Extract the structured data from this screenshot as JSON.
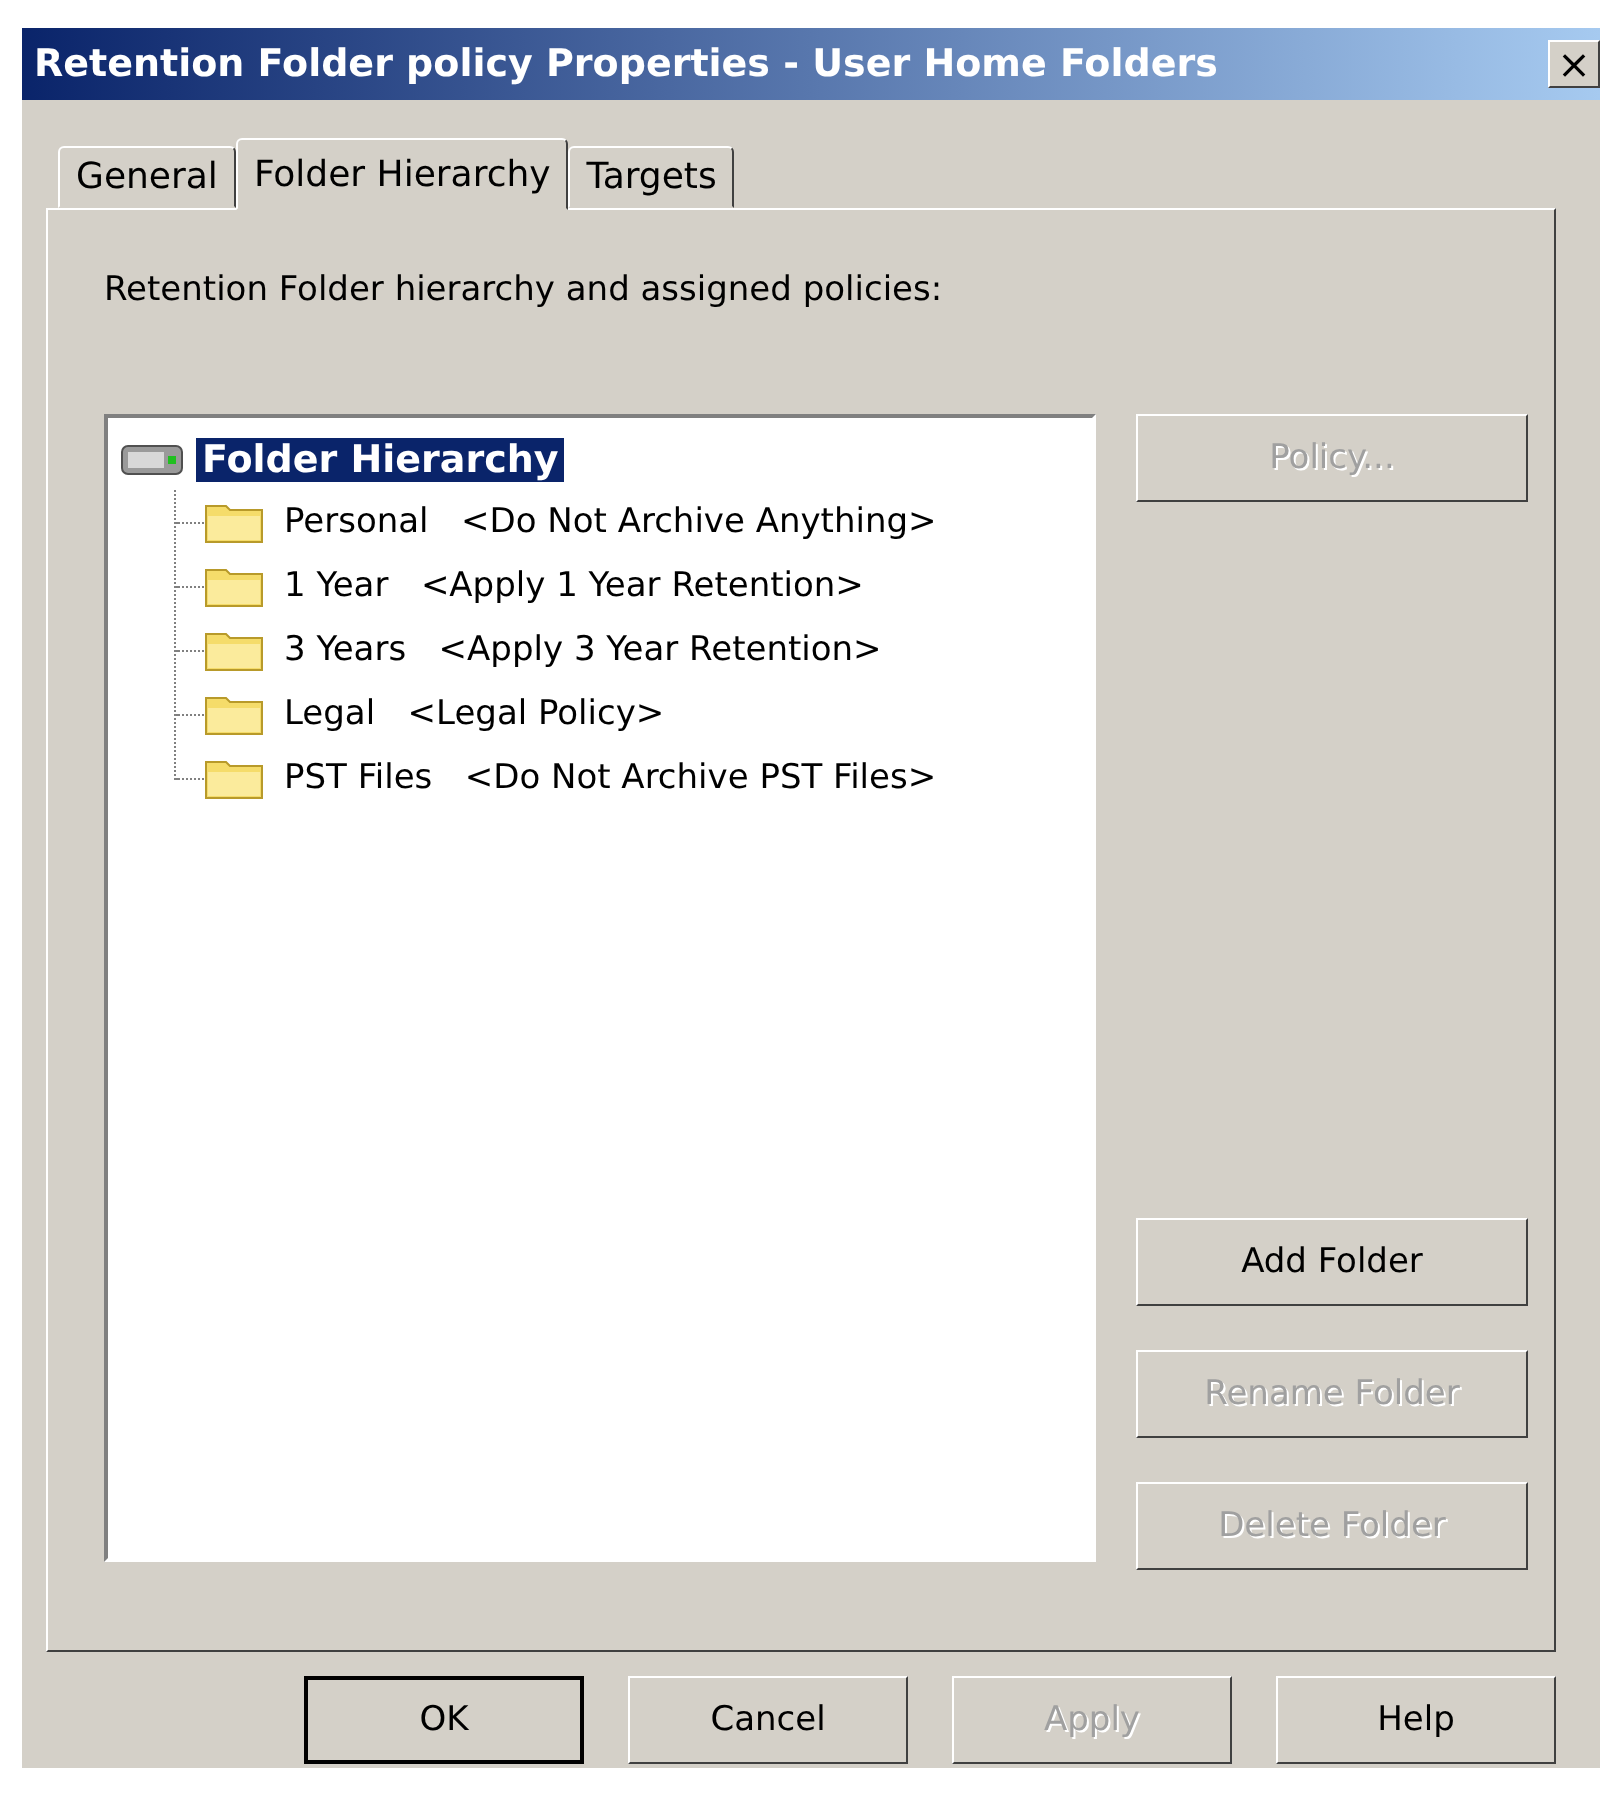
{
  "window": {
    "title": "Retention Folder policy Properties - User Home Folders",
    "close": "×"
  },
  "tabs": [
    {
      "label": "General",
      "selected": false
    },
    {
      "label": "Folder Hierarchy",
      "selected": true
    },
    {
      "label": "Targets",
      "selected": false
    }
  ],
  "panel": {
    "label": "Retention Folder hierarchy and assigned policies:"
  },
  "tree": {
    "root": {
      "label": "Folder Hierarchy",
      "selected": true
    },
    "children": [
      {
        "name": "Personal",
        "policy": "<Do Not Archive Anything>",
        "selected": false
      },
      {
        "name": "1 Year",
        "policy": "<Apply 1 Year Retention>",
        "selected": false
      },
      {
        "name": "3 Years",
        "policy": "<Apply 3 Year Retention>",
        "selected": false
      },
      {
        "name": "Legal",
        "policy": "<Legal Policy>",
        "selected": false
      },
      {
        "name": "PST Files",
        "policy": "<Do Not Archive PST Files>",
        "selected": false
      }
    ]
  },
  "policy_button": {
    "label": "Policy...",
    "disabled": true
  },
  "folder_buttons": [
    {
      "label": "Add Folder",
      "disabled": false
    },
    {
      "label": "Rename Folder",
      "disabled": true
    },
    {
      "label": "Delete Folder",
      "disabled": true
    }
  ],
  "buttons": [
    {
      "label": "OK",
      "disabled": false,
      "default": true
    },
    {
      "label": "Cancel",
      "disabled": false,
      "default": false
    },
    {
      "label": "Apply",
      "disabled": true,
      "default": false
    },
    {
      "label": "Help",
      "disabled": false,
      "default": false
    }
  ]
}
